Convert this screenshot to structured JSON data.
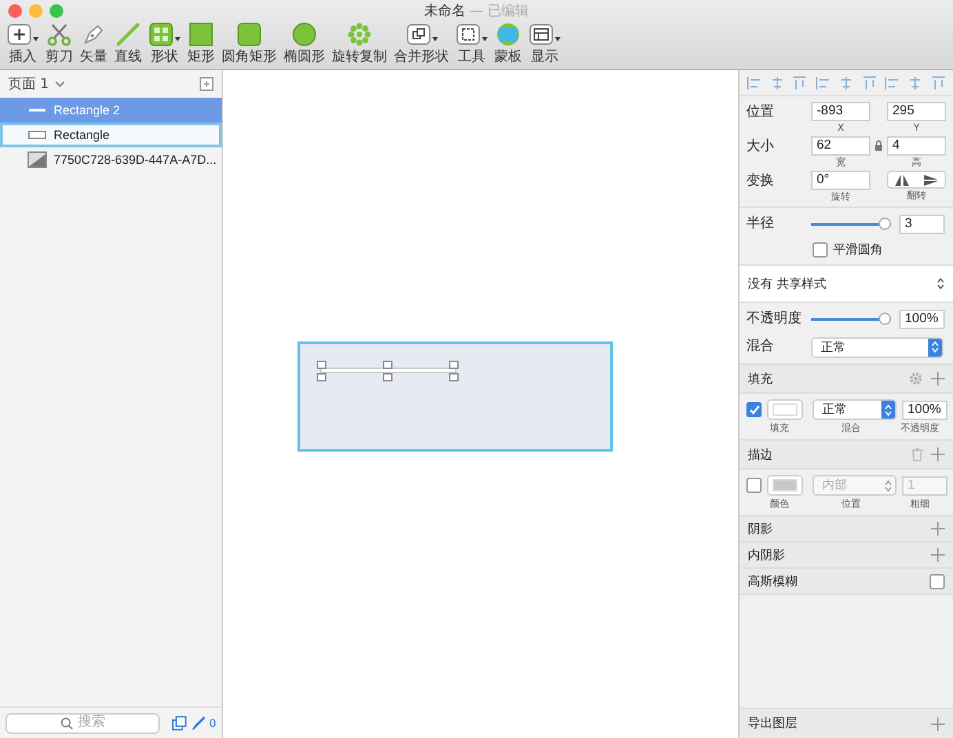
{
  "window": {
    "title": "未命名",
    "status": "— 已编辑"
  },
  "toolbar": [
    {
      "label": "插入",
      "kind": "insert",
      "menu": true
    },
    {
      "label": "剪刀",
      "kind": "scissors",
      "menu": false
    },
    {
      "label": "矢量",
      "kind": "pen",
      "menu": false
    },
    {
      "label": "直线",
      "kind": "line",
      "menu": false
    },
    {
      "label": "形状",
      "kind": "shapes",
      "menu": true
    },
    {
      "label": "矩形",
      "kind": "rect",
      "menu": false
    },
    {
      "label": "圆角矩形",
      "kind": "rounded",
      "menu": false
    },
    {
      "label": "椭圆形",
      "kind": "oval",
      "menu": false
    },
    {
      "label": "旋转复制",
      "kind": "rotate",
      "menu": false
    },
    {
      "label": "合并形状",
      "kind": "combine",
      "menu": true
    },
    {
      "label": "工具",
      "kind": "tools",
      "menu": true
    },
    {
      "label": "蒙板",
      "kind": "mask",
      "menu": false
    },
    {
      "label": "显示",
      "kind": "view",
      "menu": true
    }
  ],
  "sidebar": {
    "page": "页面 1",
    "layers": [
      {
        "name": "Rectangle 2",
        "kind": "line",
        "selected": true,
        "hovered": false
      },
      {
        "name": "Rectangle",
        "kind": "rect",
        "selected": false,
        "hovered": true
      },
      {
        "name": "7750C728-639D-447A-A7D...",
        "kind": "image",
        "selected": false,
        "hovered": false
      }
    ],
    "search": {
      "placeholder": "搜索"
    },
    "slice_count": "0"
  },
  "inspector": {
    "rows": [
      {
        "kind": "pair",
        "label": "位置",
        "lock": false,
        "fields": [
          {
            "value": "-893",
            "caption": "X"
          },
          {
            "value": "295",
            "caption": "Y"
          }
        ]
      },
      {
        "kind": "pair",
        "label": "大小",
        "lock": true,
        "fields": [
          {
            "value": "62",
            "caption": "宽"
          },
          {
            "value": "4",
            "caption": "高"
          }
        ]
      },
      {
        "kind": "transform",
        "label": "变换",
        "fields": [
          {
            "value": "0°",
            "caption": "旋转"
          }
        ],
        "flip_caption": "翻转"
      }
    ],
    "radius": {
      "label": "半径",
      "level": 1,
      "value": "3"
    },
    "smooth_corners": {
      "label": "平滑圆角",
      "checked": false
    },
    "shared_style": "没有 共享样式",
    "opacity": {
      "label": "不透明度",
      "level": 1,
      "value": "100%"
    },
    "blending": {
      "label": "混合",
      "value": "正常"
    },
    "fills": {
      "title": "填充",
      "captions": [
        "填充",
        "混合",
        "不透明度"
      ],
      "items": [
        {
          "enabled": true,
          "color": "#ffffff",
          "blend": "正常",
          "opacity": "100%"
        }
      ]
    },
    "borders": {
      "title": "描边",
      "captions": [
        "颜色",
        "位置",
        "粗细"
      ],
      "items": [
        {
          "enabled": false,
          "color": "#c8c8c8",
          "position": "内部",
          "thickness": "1"
        }
      ]
    },
    "sections": [
      {
        "title": "阴影"
      },
      {
        "title": "内阴影"
      }
    ],
    "blur": {
      "title": "高斯模糊",
      "checked": false
    },
    "export": "导出图层"
  }
}
